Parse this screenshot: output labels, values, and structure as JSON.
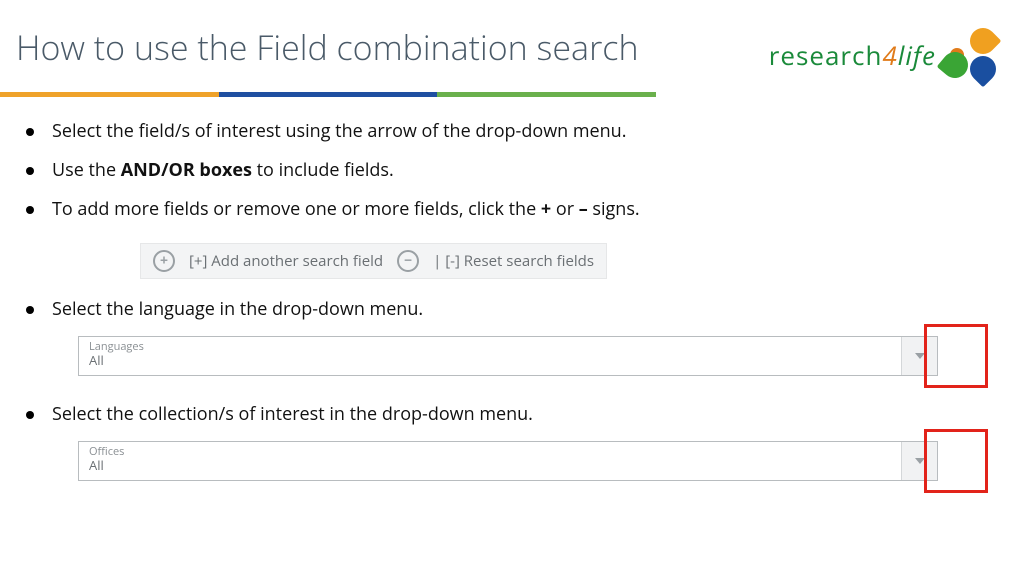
{
  "header": {
    "title": "How to use the Field combination search",
    "logo_research": "research",
    "logo_4": "4",
    "logo_life": "life"
  },
  "bullets": {
    "b1": "Select the field/s of interest using the arrow of the drop-down menu.",
    "b2_pre": "Use the ",
    "b2_bold": "AND/OR boxes",
    "b2_post": " to include fields.",
    "b3_pre": "To add more fields or remove one or more fields, click the ",
    "b3_plus": "+",
    "b3_mid": " or ",
    "b3_minus": "–",
    "b3_post": " signs.",
    "b4": "Select the language in the drop-down menu.",
    "b5": "Select the collection/s of interest in the drop-down menu."
  },
  "controls": {
    "add_label": "[+] Add another search field",
    "reset_label": "| [-] Reset search fields"
  },
  "dropdowns": {
    "lang_label": "Languages",
    "lang_value": "All",
    "off_label": "Offices",
    "off_value": "All"
  }
}
